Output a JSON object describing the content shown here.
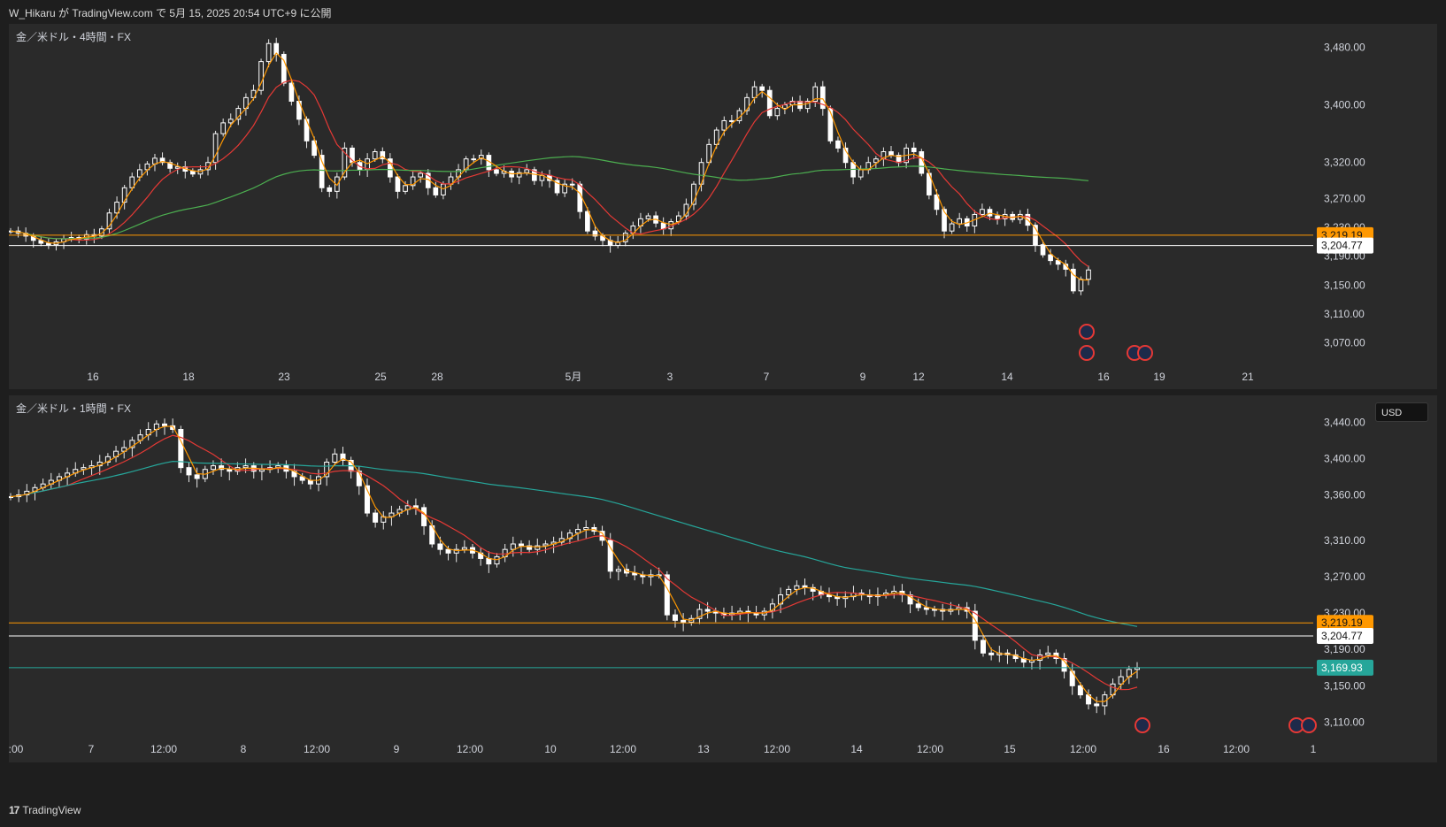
{
  "header": {
    "published": "W_Hikaru が TradingView.com で 5月 15, 2025 20:54 UTC+9 に公開"
  },
  "footer": {
    "logo_mark": "17",
    "brand": "TradingView"
  },
  "colors": {
    "up": "#e6f4f1",
    "down": "#e6f4f1",
    "sma_red": "#e53935",
    "sma_green": "#4caf50",
    "sma_teal": "#26a69a",
    "zigzag": "#ff9800",
    "level_orange": "#ff9800",
    "level_white": "#ffffff",
    "price_current": "#26a69a"
  },
  "chart_data": [
    {
      "type": "candlestick",
      "title": "金／米ドル・4時間・FX",
      "xticks": [
        "16",
        "18",
        "23",
        "25",
        "28",
        "5月",
        "3",
        "7",
        "9",
        "12",
        "14",
        "16",
        "19",
        "21"
      ],
      "yticks": [
        3480,
        3400,
        3320,
        3270,
        3230,
        3190,
        3150,
        3110,
        3070
      ],
      "ytick_labels": [
        "3,480.00",
        "3,400.00",
        "3,320.00",
        "3,270.00",
        "3,230.00",
        "3,190.00",
        "3,150.00",
        "3,110.00",
        "3,070.00"
      ],
      "ylim": [
        3040,
        3500
      ],
      "levels": [
        {
          "name": "orange",
          "value": 3219.19,
          "label": "3,219.19"
        },
        {
          "name": "white",
          "value": 3204.77,
          "label": "3,204.77"
        }
      ],
      "ohlc_close": [
        3225,
        3222,
        3218,
        3212,
        3208,
        3206,
        3210,
        3214,
        3216,
        3214,
        3220,
        3218,
        3228,
        3250,
        3265,
        3285,
        3300,
        3310,
        3318,
        3326,
        3320,
        3312,
        3314,
        3308,
        3304,
        3310,
        3320,
        3360,
        3375,
        3380,
        3395,
        3410,
        3420,
        3460,
        3485,
        3470,
        3430,
        3405,
        3380,
        3350,
        3330,
        3285,
        3280,
        3300,
        3340,
        3320,
        3310,
        3325,
        3335,
        3325,
        3300,
        3280,
        3288,
        3300,
        3305,
        3285,
        3275,
        3290,
        3300,
        3310,
        3325,
        3325,
        3330,
        3310,
        3305,
        3308,
        3300,
        3306,
        3310,
        3295,
        3302,
        3295,
        3278,
        3290,
        3290,
        3252,
        3225,
        3218,
        3212,
        3205,
        3210,
        3222,
        3232,
        3242,
        3246,
        3236,
        3228,
        3238,
        3246,
        3262,
        3290,
        3320,
        3345,
        3365,
        3378,
        3378,
        3392,
        3410,
        3425,
        3420,
        3385,
        3395,
        3400,
        3405,
        3395,
        3405,
        3425,
        3395,
        3350,
        3340,
        3320,
        3300,
        3310,
        3320,
        3325,
        3335,
        3330,
        3320,
        3340,
        3335,
        3305,
        3275,
        3255,
        3225,
        3235,
        3242,
        3232,
        3248,
        3255,
        3246,
        3242,
        3248,
        3241,
        3248,
        3233,
        3206,
        3192,
        3184,
        3179,
        3172,
        3142,
        3158,
        3171
      ]
    },
    {
      "type": "candlestick",
      "title": "金／米ドル・1時間・FX",
      "currency_button": "USD",
      "xticks": [
        ":00",
        "7",
        "12:00",
        "8",
        "12:00",
        "9",
        "12:00",
        "10",
        "12:00",
        "13",
        "12:00",
        "14",
        "12:00",
        "15",
        "12:00",
        "16",
        "12:00",
        "1"
      ],
      "yticks": [
        3440,
        3400,
        3360,
        3310,
        3270,
        3230,
        3190,
        3150,
        3110
      ],
      "ytick_labels": [
        "3,440.00",
        "3,400.00",
        "3,360.00",
        "3,310.00",
        "3,270.00",
        "3,230.00",
        "3,190.00",
        "3,150.00",
        "3,110.00"
      ],
      "ylim": [
        3090,
        3450
      ],
      "levels": [
        {
          "name": "orange",
          "value": 3219.19,
          "label": "3,219.19"
        },
        {
          "name": "white",
          "value": 3204.77,
          "label": "3,204.77"
        },
        {
          "name": "current",
          "value": 3169.93,
          "label": "3,169.93"
        }
      ],
      "ohlc_close": [
        3358,
        3360,
        3364,
        3368,
        3372,
        3376,
        3380,
        3384,
        3388,
        3390,
        3392,
        3396,
        3402,
        3408,
        3412,
        3420,
        3426,
        3432,
        3438,
        3436,
        3432,
        3390,
        3382,
        3378,
        3388,
        3392,
        3388,
        3386,
        3390,
        3392,
        3386,
        3388,
        3390,
        3392,
        3386,
        3380,
        3376,
        3372,
        3380,
        3396,
        3405,
        3398,
        3386,
        3370,
        3340,
        3330,
        3336,
        3340,
        3344,
        3348,
        3346,
        3326,
        3306,
        3300,
        3296,
        3300,
        3302,
        3296,
        3290,
        3284,
        3292,
        3300,
        3306,
        3304,
        3300,
        3304,
        3306,
        3308,
        3312,
        3318,
        3322,
        3324,
        3320,
        3310,
        3276,
        3278,
        3274,
        3272,
        3270,
        3272,
        3272,
        3228,
        3222,
        3220,
        3224,
        3234,
        3232,
        3230,
        3228,
        3230,
        3232,
        3230,
        3228,
        3232,
        3240,
        3250,
        3256,
        3260,
        3258,
        3254,
        3250,
        3248,
        3246,
        3248,
        3252,
        3250,
        3248,
        3250,
        3252,
        3254,
        3250,
        3240,
        3236,
        3234,
        3234,
        3232,
        3234,
        3236,
        3232,
        3200,
        3186,
        3184,
        3186,
        3184,
        3180,
        3176,
        3178,
        3184,
        3186,
        3180,
        3166,
        3150,
        3140,
        3130,
        3128,
        3140,
        3152,
        3160,
        3168,
        3170
      ]
    }
  ]
}
